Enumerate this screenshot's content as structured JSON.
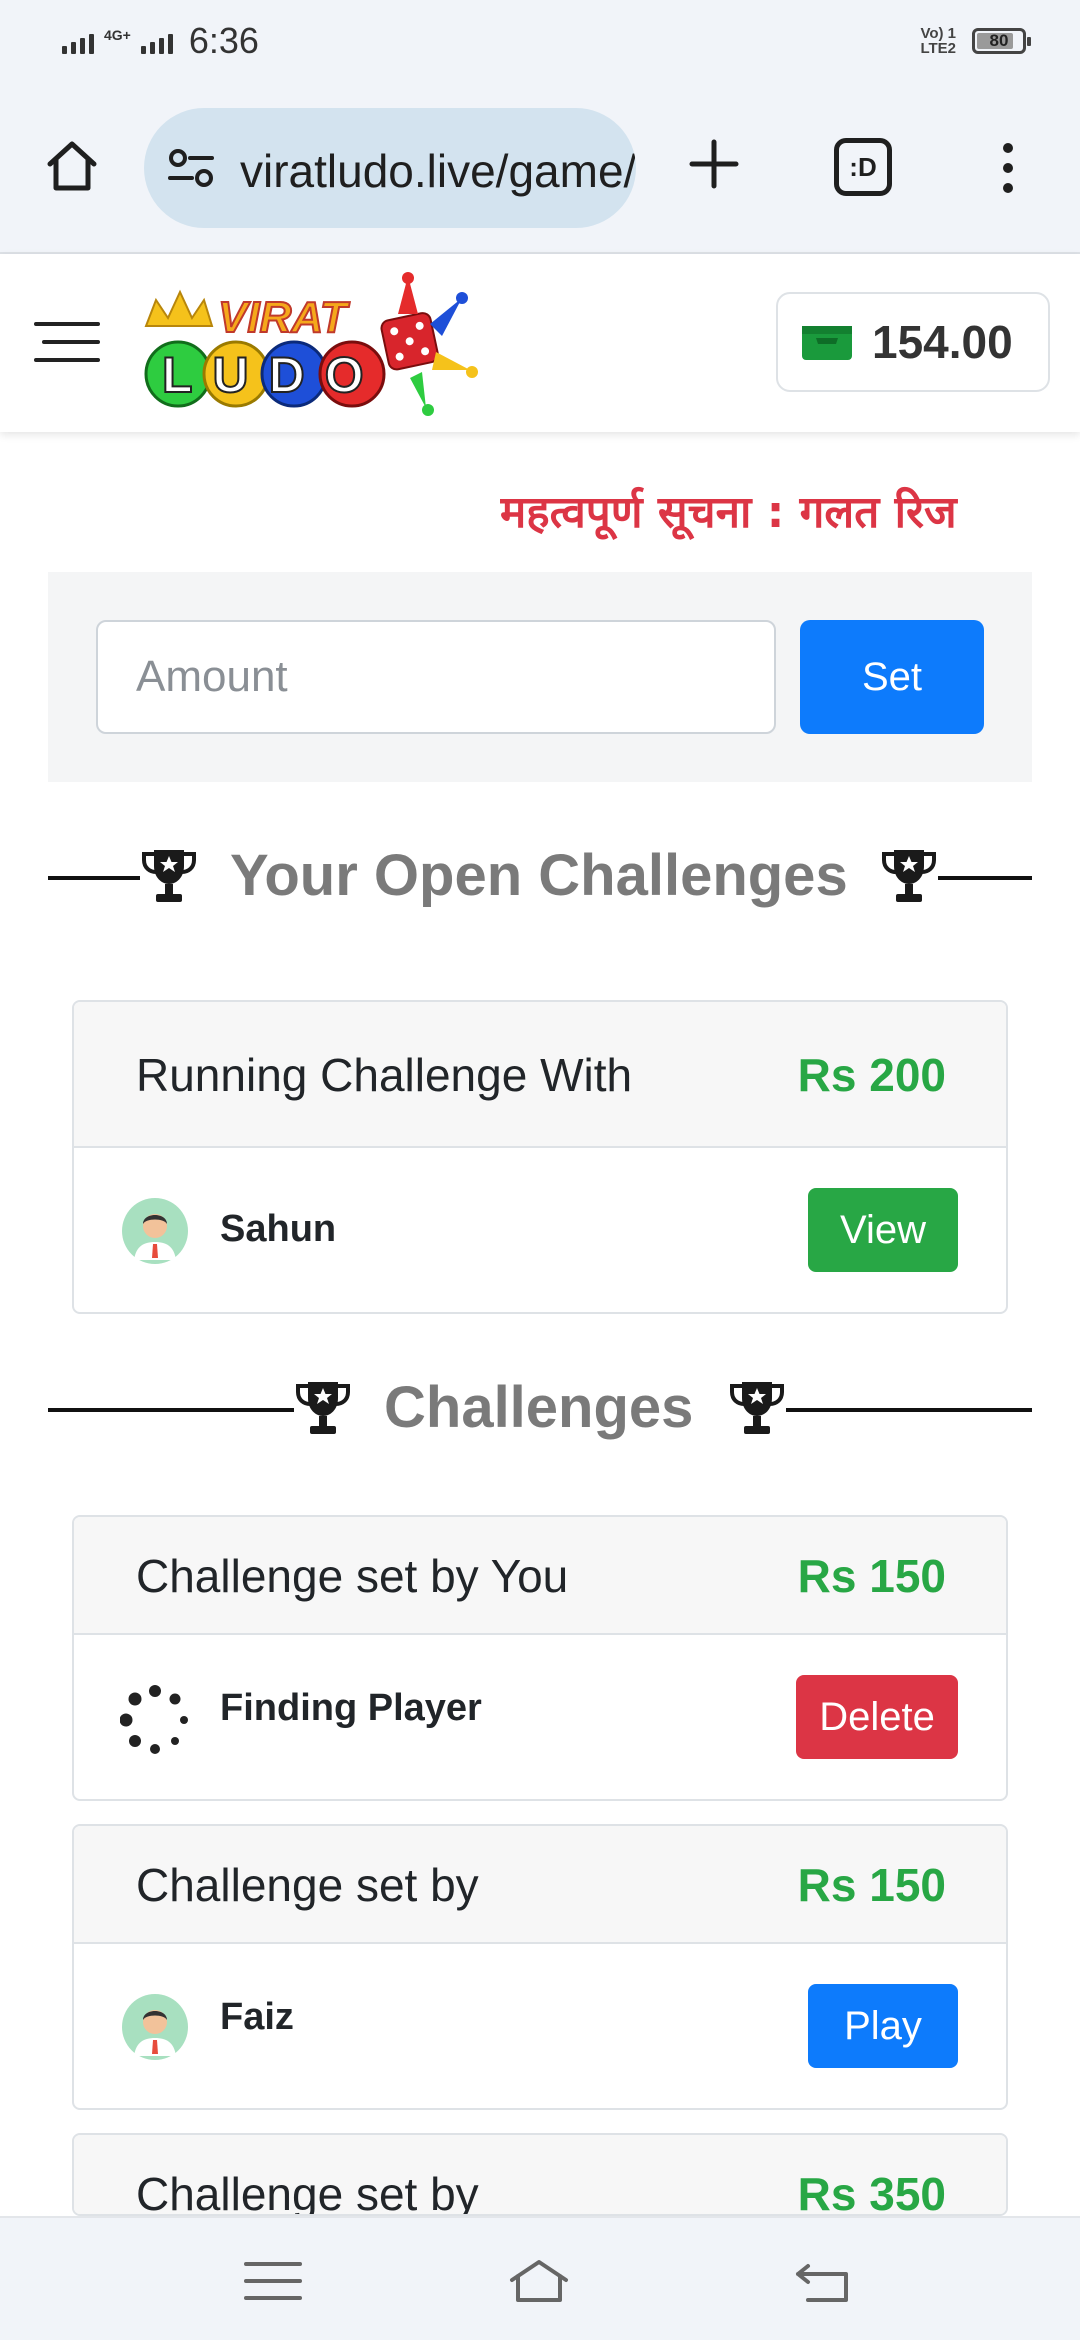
{
  "status_bar": {
    "network": "4G+",
    "time": "6:36",
    "volte": "Vo) 1\nLTE2",
    "battery": "80"
  },
  "browser": {
    "url": "viratludo.live/game/listing",
    "tab_label": ":D"
  },
  "header": {
    "logo_text_top": "VIRAT",
    "logo_text_bottom": "LUDO",
    "wallet_amount": "154.00"
  },
  "notice": {
    "text": "महत्वपूर्ण सूचना : गलत रिज"
  },
  "set_panel": {
    "amount_placeholder": "Amount",
    "amount_value": "",
    "set_label": "Set"
  },
  "open_challenges": {
    "heading": "Your Open Challenges",
    "card": {
      "title": "Running Challenge With",
      "amount": "Rs 200",
      "player": "Sahun",
      "action": "View"
    }
  },
  "challenges": {
    "heading": "Challenges",
    "items": [
      {
        "title": "Challenge set by You",
        "amount": "Rs 150",
        "player": "Finding Player",
        "action": "Delete"
      },
      {
        "title": "Challenge set by",
        "amount": "Rs 150",
        "player": "Faiz",
        "action": "Play"
      },
      {
        "title": "Challenge set by",
        "amount": "Rs 350"
      }
    ]
  },
  "colors": {
    "primary": "#0d7bfc",
    "success": "#28a745",
    "danger": "#dc3545",
    "heading_gray": "#7a7a7a"
  }
}
